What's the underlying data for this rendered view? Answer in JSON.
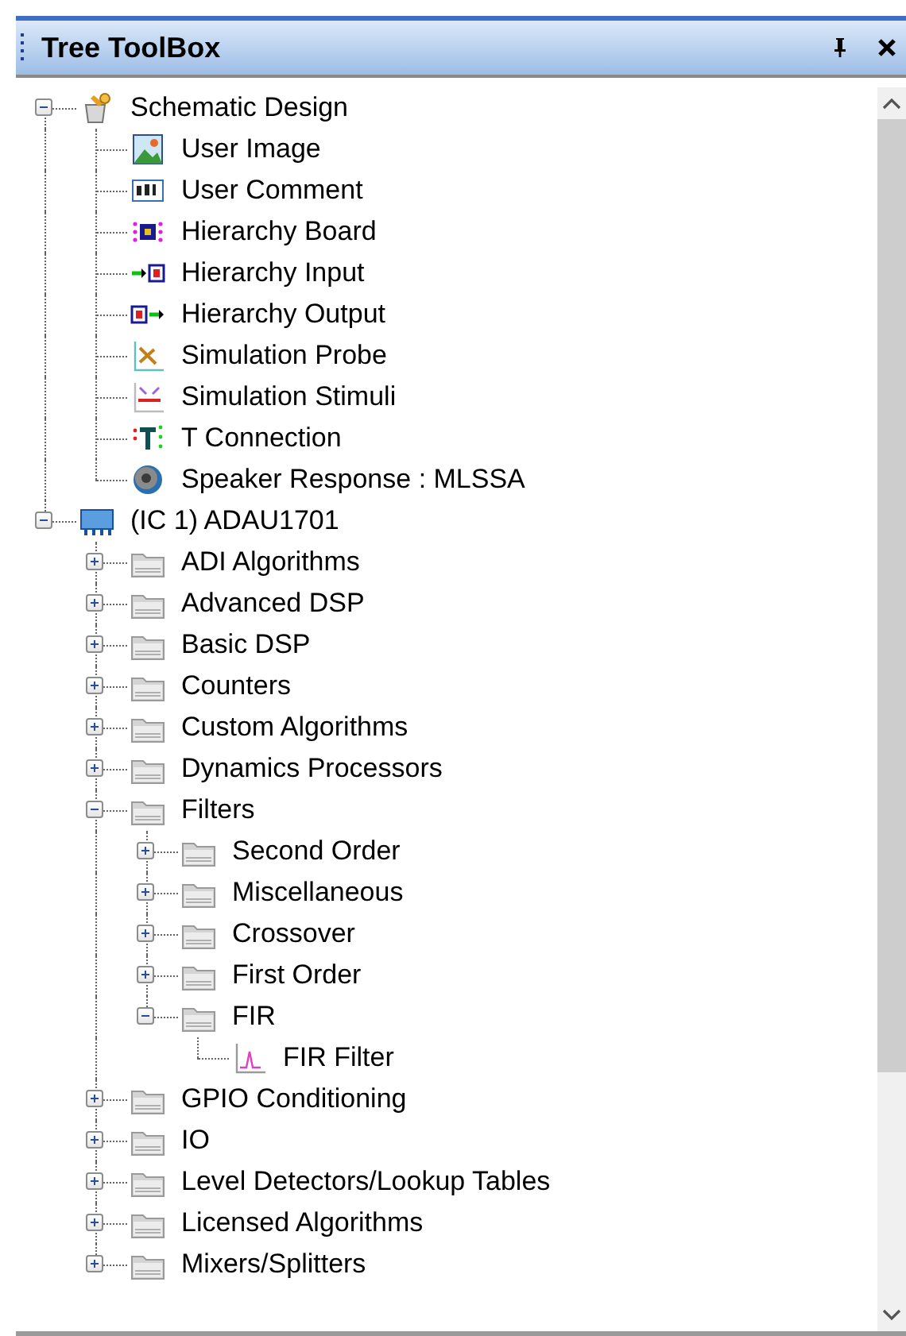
{
  "panel": {
    "title": "Tree ToolBox"
  },
  "tree": [
    {
      "label": "Schematic Design",
      "kind": "design",
      "expanded": true,
      "children": [
        {
          "label": "User Image",
          "kind": "image"
        },
        {
          "label": "User Comment",
          "kind": "comment"
        },
        {
          "label": "Hierarchy Board",
          "kind": "board"
        },
        {
          "label": "Hierarchy Input",
          "kind": "input"
        },
        {
          "label": "Hierarchy Output",
          "kind": "output"
        },
        {
          "label": "Simulation Probe",
          "kind": "probe"
        },
        {
          "label": "Simulation Stimuli",
          "kind": "stimuli"
        },
        {
          "label": "T Connection",
          "kind": "tconn"
        },
        {
          "label": "Speaker Response : MLSSA",
          "kind": "speaker"
        }
      ]
    },
    {
      "label": "(IC 1) ADAU1701",
      "kind": "chip",
      "expanded": true,
      "children": [
        {
          "label": "ADI Algorithms",
          "kind": "folder",
          "expanded": false
        },
        {
          "label": "Advanced DSP",
          "kind": "folder",
          "expanded": false
        },
        {
          "label": "Basic DSP",
          "kind": "folder",
          "expanded": false
        },
        {
          "label": "Counters",
          "kind": "folder",
          "expanded": false
        },
        {
          "label": "Custom Algorithms",
          "kind": "folder",
          "expanded": false
        },
        {
          "label": "Dynamics Processors",
          "kind": "folder",
          "expanded": false
        },
        {
          "label": "Filters",
          "kind": "folder",
          "expanded": true,
          "children": [
            {
              "label": "Second Order",
              "kind": "folder",
              "expanded": false
            },
            {
              "label": "Miscellaneous",
              "kind": "folder",
              "expanded": false
            },
            {
              "label": "Crossover",
              "kind": "folder",
              "expanded": false
            },
            {
              "label": "First Order",
              "kind": "folder",
              "expanded": false
            },
            {
              "label": "FIR",
              "kind": "folder",
              "expanded": true,
              "children": [
                {
                  "label": "FIR Filter",
                  "kind": "fir"
                }
              ]
            }
          ]
        },
        {
          "label": "GPIO Conditioning",
          "kind": "folder",
          "expanded": false
        },
        {
          "label": "IO",
          "kind": "folder",
          "expanded": false
        },
        {
          "label": "Level Detectors/Lookup Tables",
          "kind": "folder",
          "expanded": false
        },
        {
          "label": "Licensed Algorithms",
          "kind": "folder",
          "expanded": false
        },
        {
          "label": "Mixers/Splitters",
          "kind": "folder",
          "expanded": false
        }
      ]
    }
  ]
}
